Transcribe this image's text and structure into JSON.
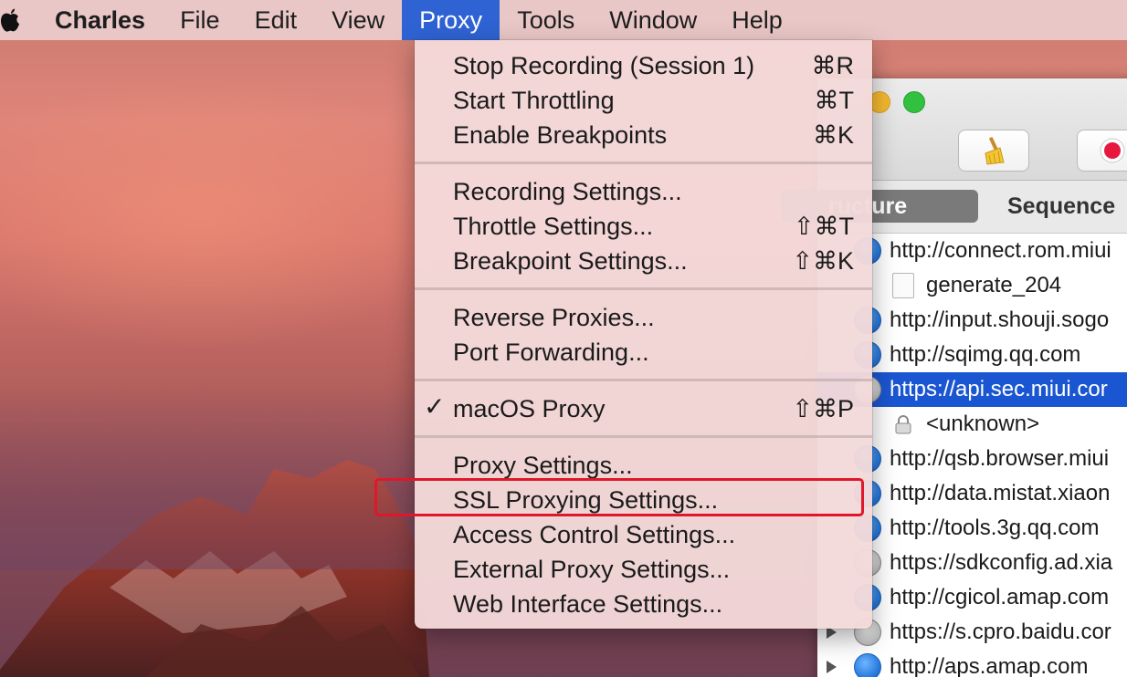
{
  "menubar": {
    "app_name": "Charles",
    "items": [
      "File",
      "Edit",
      "View",
      "Proxy",
      "Tools",
      "Window",
      "Help"
    ],
    "active": "Proxy"
  },
  "proxy_menu": {
    "group1": [
      {
        "label": "Stop Recording (Session 1)",
        "shortcut": "⌘R"
      },
      {
        "label": "Start Throttling",
        "shortcut": "⌘T"
      },
      {
        "label": "Enable Breakpoints",
        "shortcut": "⌘K"
      }
    ],
    "group2": [
      {
        "label": "Recording Settings...",
        "shortcut": ""
      },
      {
        "label": "Throttle Settings...",
        "shortcut": "⇧⌘T"
      },
      {
        "label": "Breakpoint Settings...",
        "shortcut": "⇧⌘K"
      }
    ],
    "group3": [
      {
        "label": "Reverse Proxies...",
        "shortcut": ""
      },
      {
        "label": "Port Forwarding...",
        "shortcut": ""
      }
    ],
    "group4": [
      {
        "label": "macOS Proxy",
        "shortcut": "⇧⌘P",
        "checked": true,
        "check_glyph": "✓"
      }
    ],
    "group5": [
      {
        "label": "Proxy Settings...",
        "shortcut": ""
      },
      {
        "label": "SSL Proxying Settings...",
        "shortcut": "",
        "annotated": true
      },
      {
        "label": "Access Control Settings...",
        "shortcut": ""
      },
      {
        "label": "External Proxy Settings...",
        "shortcut": ""
      },
      {
        "label": "Web Interface Settings...",
        "shortcut": ""
      }
    ]
  },
  "window": {
    "tabs": {
      "structure": "ructure",
      "sequence": "Sequence"
    },
    "toolbar": {
      "broom_icon": "broom-icon",
      "record_icon": "record-icon"
    },
    "tree": [
      {
        "label": "http://connect.rom.miui",
        "icon": "globe-icon"
      },
      {
        "label": "generate_204",
        "icon": "document-icon",
        "child": true
      },
      {
        "label": "http://input.shouji.sogo",
        "icon": "globe-icon"
      },
      {
        "label": "http://sqimg.qq.com",
        "icon": "globe-icon"
      },
      {
        "label": "https://api.sec.miui.cor",
        "icon": "locked-globe-icon",
        "selected": true
      },
      {
        "label": "<unknown>",
        "icon": "padlock-icon",
        "child": true
      },
      {
        "label": "http://qsb.browser.miui",
        "icon": "globe-icon"
      },
      {
        "label": "http://data.mistat.xiaon",
        "icon": "globe-icon"
      },
      {
        "label": "http://tools.3g.qq.com",
        "icon": "globe-icon"
      },
      {
        "label": "https://sdkconfig.ad.xia",
        "icon": "locked-globe-icon"
      },
      {
        "label": "http://cgicol.amap.com",
        "icon": "globe-icon"
      },
      {
        "label": "https://s.cpro.baidu.cor",
        "icon": "locked-globe-icon"
      },
      {
        "label": "http://aps.amap.com",
        "icon": "globe-icon"
      }
    ]
  },
  "colors": {
    "menu_active": "#2f63d3",
    "selection": "#1b56d2",
    "annotation": "#e0172a",
    "traffic_yellow": "#f5b92f",
    "traffic_green": "#31c13f"
  }
}
